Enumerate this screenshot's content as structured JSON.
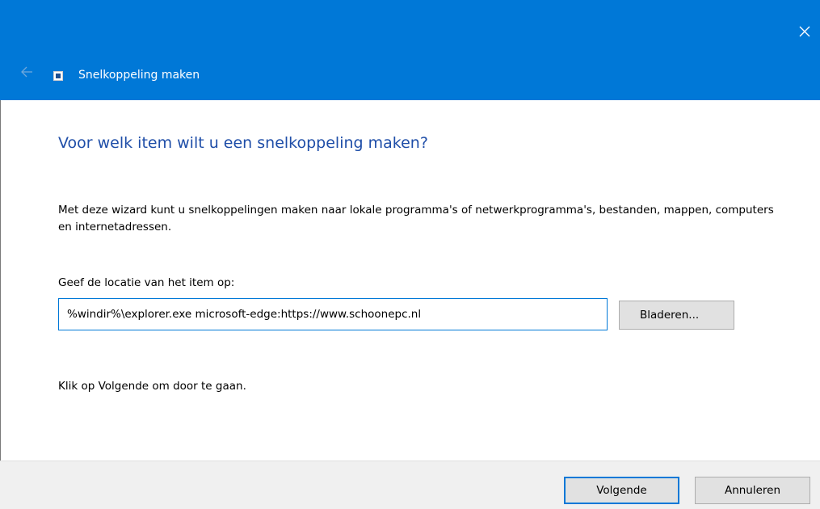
{
  "window": {
    "title": "Snelkoppeling maken",
    "accent_color": "#0078d7",
    "heading_color": "#1f4ea8",
    "close_icon": "close-icon",
    "back_icon": "back-arrow-icon",
    "app_icon": "shortcut-icon"
  },
  "content": {
    "heading": "Voor welk item wilt u een snelkoppeling maken?",
    "description": "Met deze wizard kunt u snelkoppelingen maken naar lokale programma's of netwerkprogramma's, bestanden, mappen, computers en internetadressen.",
    "location_label": "Geef de locatie van het item op:",
    "location_value": "%windir%\\explorer.exe microsoft-edge:https://www.schoonepc.nl",
    "browse_label": "Bladeren...",
    "hint": "Klik op Volgende om door te gaan."
  },
  "footer": {
    "next_label": "Volgende",
    "cancel_label": "Annuleren"
  }
}
